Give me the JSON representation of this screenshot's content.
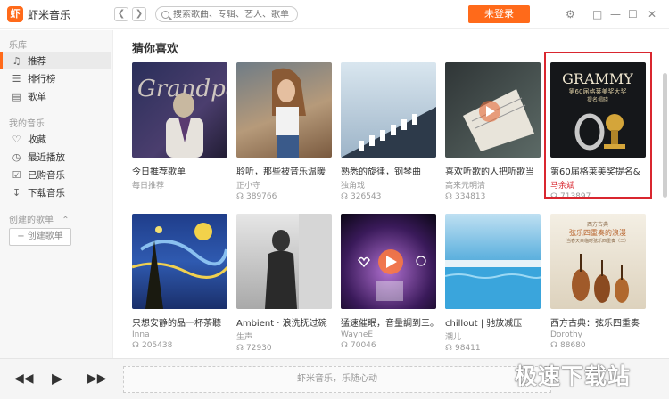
{
  "app": {
    "logo_badge": "虾",
    "name": "虾米音乐"
  },
  "search": {
    "placeholder": "搜索歌曲、专辑、艺人、歌单"
  },
  "header": {
    "login_label": "未登录"
  },
  "sidebar": {
    "library_title": "乐库",
    "library_items": [
      {
        "label": "推荐",
        "icon": "music-note-icon"
      },
      {
        "label": "排行榜",
        "icon": "chart-icon"
      },
      {
        "label": "歌单",
        "icon": "playlist-icon"
      }
    ],
    "my_music_title": "我的音乐",
    "my_items": [
      {
        "label": "收藏",
        "icon": "heart-icon"
      },
      {
        "label": "最近播放",
        "icon": "clock-icon"
      },
      {
        "label": "已购音乐",
        "icon": "cart-icon"
      },
      {
        "label": "下载音乐",
        "icon": "download-icon"
      }
    ],
    "created_title": "创建的歌单",
    "create_button": "+ 创建歌单"
  },
  "main": {
    "section_title": "猜你喜欢",
    "cards": [
      {
        "title": "今日推荐歌单",
        "sub": "每日推荐",
        "plays": ""
      },
      {
        "title": "聆听，那些被音乐温暖",
        "sub": "正小守",
        "plays": "389766"
      },
      {
        "title": "熟悉的旋律，钢琴曲",
        "sub": "独角戏",
        "plays": "326543"
      },
      {
        "title": "喜欢听歌的人把听歌当",
        "sub": "高来元明清",
        "plays": "334813"
      },
      {
        "title": "第60届格莱美奖提名&",
        "sub": "马余斌",
        "plays": "713897"
      },
      {
        "title": "只想安静的品一杯茶聽",
        "sub": "Inna",
        "plays": "205438"
      },
      {
        "title": "Ambient · 浪洗抚过碗",
        "sub": "生声",
        "plays": "72930"
      },
      {
        "title": "猛速催眠，音量調到三。",
        "sub": "WayneE",
        "plays": "70046"
      },
      {
        "title": "chillout | 驰放减压",
        "sub": "潮儿",
        "plays": "98411"
      },
      {
        "title": "西方古典：弦乐四重奏",
        "sub": "Dorothy",
        "plays": "88680"
      }
    ],
    "grammy_text": {
      "big": "GRAMMY",
      "line1": "第60届格莱美奖大奖",
      "line2": "提名揭晓"
    },
    "cover_text": {
      "top": "西方古典",
      "mid": "弦乐四重奏的浪漫",
      "bottom": "当春天来临时弦乐四重奏（二）"
    }
  },
  "player": {
    "prev": "◀◀",
    "play": "▶",
    "next": "▶▶",
    "now_playing": "虾米音乐，乐随心动"
  },
  "watermark": "极速下载站",
  "accent": "#ff6a1a"
}
